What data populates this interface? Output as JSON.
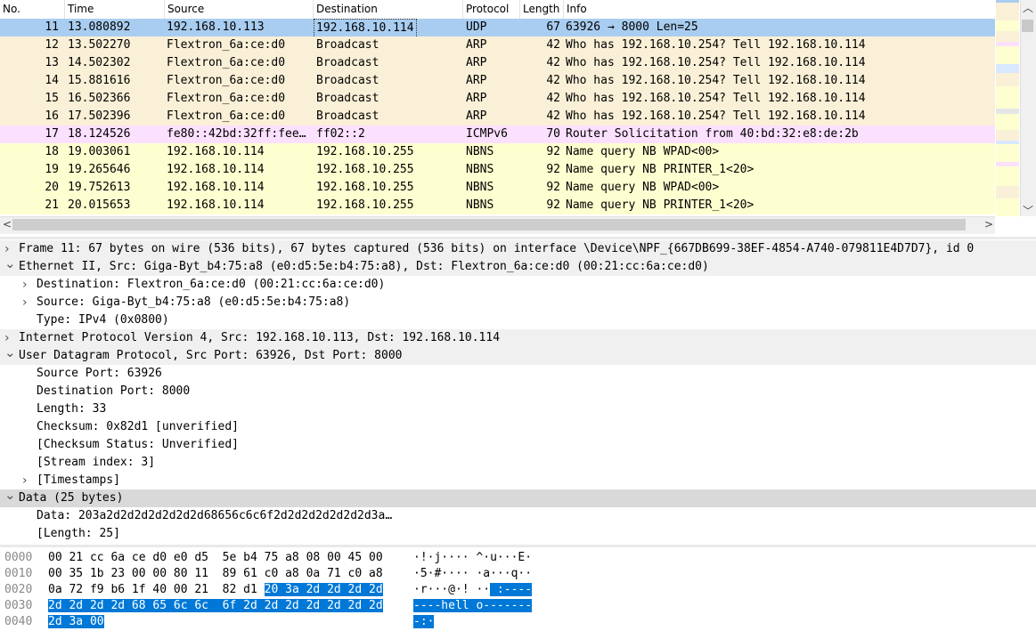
{
  "columns": [
    "No.",
    "Time",
    "Source",
    "Destination",
    "Protocol",
    "Length",
    "Info"
  ],
  "packets": [
    {
      "no": "11",
      "time": "13.080892",
      "src": "192.168.10.113",
      "dst": "192.168.10.114",
      "proto": "UDP",
      "len": "67",
      "info": "63926 → 8000 Len=25",
      "bg": "#a9cdf0",
      "selected": true
    },
    {
      "no": "12",
      "time": "13.502270",
      "src": "Flextron_6a:ce:d0",
      "dst": "Broadcast",
      "proto": "ARP",
      "len": "42",
      "info": "Who has 192.168.10.254? Tell 192.168.10.114",
      "bg": "#faf0d7"
    },
    {
      "no": "13",
      "time": "14.502302",
      "src": "Flextron_6a:ce:d0",
      "dst": "Broadcast",
      "proto": "ARP",
      "len": "42",
      "info": "Who has 192.168.10.254? Tell 192.168.10.114",
      "bg": "#faf0d7"
    },
    {
      "no": "14",
      "time": "15.881616",
      "src": "Flextron_6a:ce:d0",
      "dst": "Broadcast",
      "proto": "ARP",
      "len": "42",
      "info": "Who has 192.168.10.254? Tell 192.168.10.114",
      "bg": "#faf0d7"
    },
    {
      "no": "15",
      "time": "16.502366",
      "src": "Flextron_6a:ce:d0",
      "dst": "Broadcast",
      "proto": "ARP",
      "len": "42",
      "info": "Who has 192.168.10.254? Tell 192.168.10.114",
      "bg": "#faf0d7"
    },
    {
      "no": "16",
      "time": "17.502396",
      "src": "Flextron_6a:ce:d0",
      "dst": "Broadcast",
      "proto": "ARP",
      "len": "42",
      "info": "Who has 192.168.10.254? Tell 192.168.10.114",
      "bg": "#faf0d7"
    },
    {
      "no": "17",
      "time": "18.124526",
      "src": "fe80::42bd:32ff:fee…",
      "dst": "ff02::2",
      "proto": "ICMPv6",
      "len": "70",
      "info": "Router Solicitation from 40:bd:32:e8:de:2b",
      "bg": "#fce0ff"
    },
    {
      "no": "18",
      "time": "19.003061",
      "src": "192.168.10.114",
      "dst": "192.168.10.255",
      "proto": "NBNS",
      "len": "92",
      "info": "Name query NB WPAD<00>",
      "bg": "#feffd0"
    },
    {
      "no": "19",
      "time": "19.265646",
      "src": "192.168.10.114",
      "dst": "192.168.10.255",
      "proto": "NBNS",
      "len": "92",
      "info": "Name query NB PRINTER_1<20>",
      "bg": "#feffd0"
    },
    {
      "no": "20",
      "time": "19.752613",
      "src": "192.168.10.114",
      "dst": "192.168.10.255",
      "proto": "NBNS",
      "len": "92",
      "info": "Name query NB WPAD<00>",
      "bg": "#feffd0"
    },
    {
      "no": "21",
      "time": "20.015653",
      "src": "192.168.10.114",
      "dst": "192.168.10.255",
      "proto": "NBNS",
      "len": "92",
      "info": "Name query NB PRINTER_1<20>",
      "bg": "#feffd0"
    }
  ],
  "details": [
    {
      "level": 0,
      "toggle": "collapsed",
      "text": "Frame 11: 67 bytes on wire (536 bits), 67 bytes captured (536 bits) on interface \\Device\\NPF_{667DB699-38EF-4854-A740-079811E4D7D7}, id 0",
      "bg": "#f0f0f0"
    },
    {
      "level": 0,
      "toggle": "expanded",
      "text": "Ethernet II, Src: Giga-Byt_b4:75:a8 (e0:d5:5e:b4:75:a8), Dst: Flextron_6a:ce:d0 (00:21:cc:6a:ce:d0)",
      "bg": "#f0f0f0"
    },
    {
      "level": 1,
      "toggle": "collapsed",
      "text": "Destination: Flextron_6a:ce:d0 (00:21:cc:6a:ce:d0)",
      "bg": "#ffffff"
    },
    {
      "level": 1,
      "toggle": "collapsed",
      "text": "Source: Giga-Byt_b4:75:a8 (e0:d5:5e:b4:75:a8)",
      "bg": "#ffffff"
    },
    {
      "level": 1,
      "toggle": "none",
      "text": "Type: IPv4 (0x0800)",
      "bg": "#ffffff"
    },
    {
      "level": 0,
      "toggle": "collapsed",
      "text": "Internet Protocol Version 4, Src: 192.168.10.113, Dst: 192.168.10.114",
      "bg": "#f0f0f0"
    },
    {
      "level": 0,
      "toggle": "expanded",
      "text": "User Datagram Protocol, Src Port: 63926, Dst Port: 8000",
      "bg": "#f0f0f0"
    },
    {
      "level": 1,
      "toggle": "none",
      "text": "Source Port: 63926",
      "bg": "#ffffff"
    },
    {
      "level": 1,
      "toggle": "none",
      "text": "Destination Port: 8000",
      "bg": "#ffffff"
    },
    {
      "level": 1,
      "toggle": "none",
      "text": "Length: 33",
      "bg": "#ffffff"
    },
    {
      "level": 1,
      "toggle": "none",
      "text": "Checksum: 0x82d1 [unverified]",
      "bg": "#ffffff"
    },
    {
      "level": 1,
      "toggle": "none",
      "text": "[Checksum Status: Unverified]",
      "bg": "#ffffff"
    },
    {
      "level": 1,
      "toggle": "none",
      "text": "[Stream index: 3]",
      "bg": "#ffffff"
    },
    {
      "level": 1,
      "toggle": "collapsed",
      "text": "[Timestamps]",
      "bg": "#ffffff"
    },
    {
      "level": 0,
      "toggle": "expanded",
      "text": "Data (25 bytes)",
      "bg": "#d9d9d9"
    },
    {
      "level": 1,
      "toggle": "none",
      "text": "Data: 203a2d2d2d2d2d2d2d68656c6c6f2d2d2d2d2d2d2d3a…",
      "bg": "#ffffff"
    },
    {
      "level": 1,
      "toggle": "none",
      "text": "[Length: 25]",
      "bg": "#ffffff"
    }
  ],
  "bytes": [
    {
      "offset": "0000",
      "hex_plain": "00 21 cc 6a ce d0 e0 d5  5e b4 75 a8 08 00 45 00",
      "hex_hl": "",
      "ascii_plain": "·!·j···· ^·u···E·",
      "ascii_hl": ""
    },
    {
      "offset": "0010",
      "hex_plain": "00 35 1b 23 00 00 80 11  89 61 c0 a8 0a 71 c0 a8",
      "hex_hl": "",
      "ascii_plain": "·5·#···· ·a···q··",
      "ascii_hl": ""
    },
    {
      "offset": "0020",
      "hex_plain": "0a 72 f9 b6 1f 40 00 21  82 d1 ",
      "hex_hl": "20 3a 2d 2d 2d 2d",
      "ascii_plain": "·r···@·! ··",
      "ascii_hl": " :----"
    },
    {
      "offset": "0030",
      "hex_plain": "",
      "hex_hl": "2d 2d 2d 2d 68 65 6c 6c  6f 2d 2d 2d 2d 2d 2d 2d",
      "ascii_plain": "",
      "ascii_hl": "----hell o-------"
    },
    {
      "offset": "0040",
      "hex_plain": "",
      "hex_hl": "2d 3a 00",
      "ascii_plain": "",
      "ascii_hl": "-:·"
    }
  ]
}
